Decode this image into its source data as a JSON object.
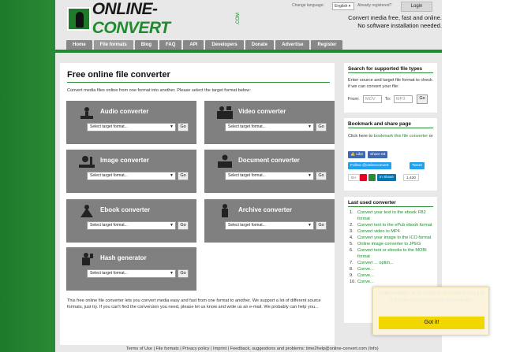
{
  "header": {
    "logo_text_1": "ONLINE-",
    "logo_text_2": "CONVERT",
    "logo_com": ".COM",
    "change_language_label": "Change language:",
    "language_value": "English",
    "already_registered_label": "Already registered?",
    "login_label": "Login",
    "tagline_1": "Convert media free, fast and online.",
    "tagline_2": "No software installation needed."
  },
  "nav": {
    "items": [
      "Home",
      "File formats",
      "Blog",
      "FAQ",
      "API",
      "Developers",
      "Donate",
      "Advertise",
      "Register"
    ],
    "active": "File formats"
  },
  "main": {
    "title": "Free online file converter",
    "intro": "Convert media files online from one format into another. Please select the target format below:",
    "converters": [
      {
        "name": "Audio converter",
        "placeholder": "Select target format...",
        "go": "Go",
        "icon": "audio-icon"
      },
      {
        "name": "Video converter",
        "placeholder": "Select target format...",
        "go": "Go",
        "icon": "video-icon"
      },
      {
        "name": "Image converter",
        "placeholder": "Select target format...",
        "go": "Go",
        "icon": "image-icon"
      },
      {
        "name": "Document converter",
        "placeholder": "Select target format...",
        "go": "Go",
        "icon": "document-icon"
      },
      {
        "name": "Ebook converter",
        "placeholder": "Select target format...",
        "go": "Go",
        "icon": "ebook-icon"
      },
      {
        "name": "Archive converter",
        "placeholder": "Select target format...",
        "go": "Go",
        "icon": "archive-icon"
      },
      {
        "name": "Hash generator",
        "placeholder": "Select target format...",
        "go": "Go",
        "icon": "hash-icon"
      }
    ],
    "bottom_text": "This free online file converter lets you convert media easy and fast from one format to another. We support a lot of different source formats, just try. If you can't find the conversion you need, please let us know and write us an e-mail. We probably can help you..."
  },
  "sidebar": {
    "search": {
      "title": "Search for supported file types",
      "text": "Enter source and target file format to check if we can convert your file:",
      "from_label": "From:",
      "from_placeholder": "MOV",
      "to_label": "To:",
      "to_placeholder": "MP3",
      "go": "Go"
    },
    "bookmark": {
      "title": "Bookmark and share page",
      "text_prefix": "Click here to ",
      "link": "bookmark this file converter",
      "text_suffix": " or",
      "like": "Like",
      "share": "Share 83",
      "follow": "Follow @onlineconvert",
      "tweet": "Tweet",
      "share2": "Share",
      "count": "1,430"
    },
    "last_used": {
      "title": "Last used converter",
      "items": [
        "Convert your text to the ebook FB2 format",
        "Convert text to the ePub ebook format",
        "Convert video to MP4",
        "Convert your image to the ICO format",
        "Online image converter to JPEG",
        "Convert text or ebooks to the MOBI format",
        "Convert ... optim...",
        "Conve...",
        "Conve...",
        "Conve..."
      ]
    }
  },
  "cookie": {
    "text": "This website uses cookies to ensure you get the best experience on our website.",
    "button": "Got it!"
  },
  "footer": {
    "text": "Terms of Use | File formats | Privacy policy | Imprint | Feedback, suggestions and problems: time2help@online-convert.com (Info)"
  },
  "colors": {
    "brand_green": "#1f8a2e",
    "converter_box": "#808080",
    "cookie_button": "#f1d600"
  }
}
